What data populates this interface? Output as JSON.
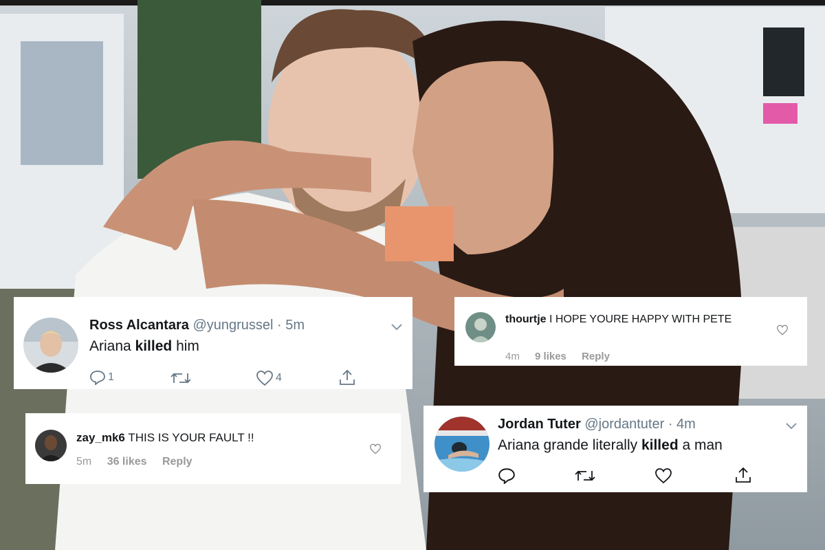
{
  "cards": [
    {
      "type": "twitter",
      "name": "Ross Alcantara",
      "handle": "@yungrussel",
      "separator": "·",
      "time": "5m",
      "text_pre": "Ariana ",
      "text_bold": "killed",
      "text_post": " him",
      "reply_count": "1",
      "like_count": "4",
      "icons": [
        "reply-icon",
        "retweet-icon",
        "like-icon",
        "share-icon",
        "chevron-down-icon"
      ]
    },
    {
      "type": "instagram",
      "username": "thourtje",
      "comment": "I HOPE YOURE HAPPY WITH PETE",
      "time": "4m",
      "likes": "9 likes",
      "reply": "Reply",
      "icons": [
        "heart-icon"
      ]
    },
    {
      "type": "instagram",
      "username": "zay_mk6",
      "comment": "THIS IS YOUR FAULT !!",
      "time": "5m",
      "likes": "36 likes",
      "reply": "Reply",
      "icons": [
        "heart-icon"
      ]
    },
    {
      "type": "twitter",
      "name": "Jordan Tuter",
      "handle": "@jordantuter",
      "separator": "·",
      "time": "4m",
      "text_pre": "Ariana grande literally ",
      "text_bold": "killed",
      "text_post": " a man",
      "reply_count": "",
      "like_count": "",
      "icons": [
        "reply-icon",
        "retweet-icon",
        "like-icon",
        "share-icon",
        "chevron-down-icon"
      ]
    }
  ],
  "colors": {
    "twitter_text": "#14171a",
    "twitter_muted": "#657786",
    "instagram_muted": "#999999"
  }
}
